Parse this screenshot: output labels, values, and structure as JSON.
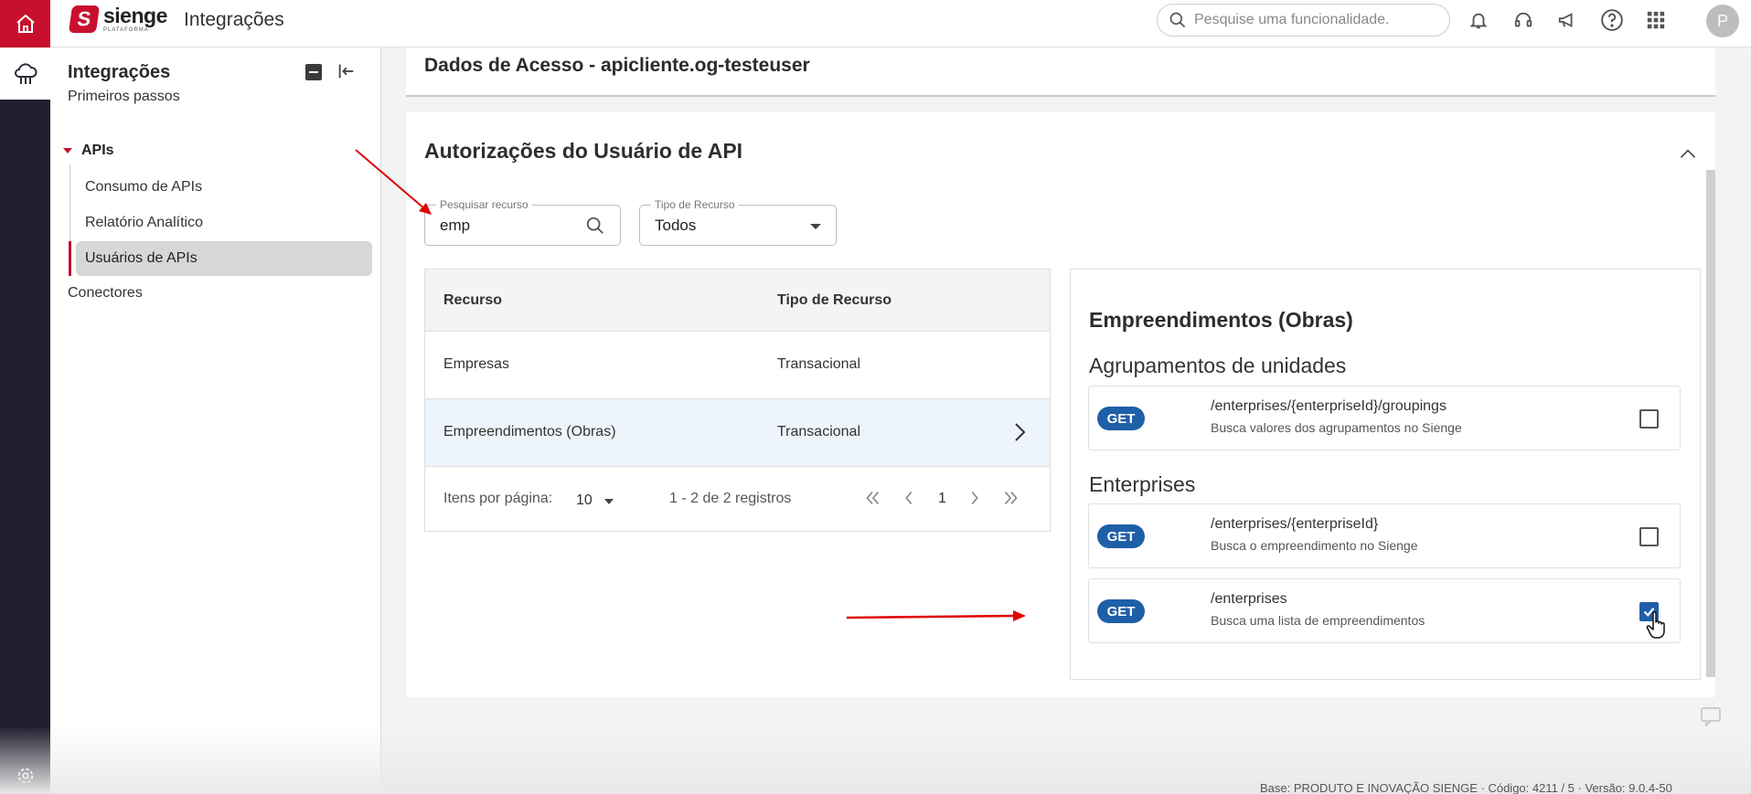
{
  "topbar": {
    "logo_name": "sienge",
    "logo_sub": "PLATAFORMA",
    "logo_letter": "S",
    "app_title": "Integrações",
    "search_placeholder": "Pesquise uma funcionalidade.",
    "avatar_letter": "P",
    "icons": [
      "bell-icon",
      "headset-icon",
      "megaphone-icon",
      "help-icon",
      "apps-grid-icon"
    ]
  },
  "rail": {
    "icons": [
      "home-icon",
      "cloud-integration-icon",
      "gear-icon"
    ],
    "accent": "#c8102e",
    "bg": "#1f1f2e"
  },
  "sidebar": {
    "title": "Integrações",
    "items": {
      "first_steps": "Primeiros passos",
      "apis": "APIs",
      "api_consumption": "Consumo de APIs",
      "analytics_report": "Relatório Analítico",
      "api_users": "Usuários de APIs",
      "connectors": "Conectores"
    }
  },
  "previous_section": {
    "title": "Dados de Acesso - apicliente.og-testeuser"
  },
  "authorizations": {
    "title": "Autorizações do Usuário de API",
    "search": {
      "label": "Pesquisar recurso",
      "value": "emp"
    },
    "type_filter": {
      "label": "Tipo de Recurso",
      "value": "Todos"
    },
    "table": {
      "headers": {
        "resource": "Recurso",
        "type": "Tipo de Recurso"
      },
      "rows": [
        {
          "resource": "Empresas",
          "type": "Transacional"
        },
        {
          "resource": "Empreendimentos (Obras)",
          "type": "Transacional"
        }
      ],
      "pagination": {
        "per_page_label": "Itens por página:",
        "per_page_value": "10",
        "range": "1 - 2 de 2 registros",
        "current_page": "1"
      }
    },
    "detail": {
      "title": "Empreendimentos (Obras)",
      "groups": [
        {
          "name": "Agrupamentos de unidades",
          "endpoints": [
            {
              "method": "GET",
              "path": "/enterprises/{enterpriseId}/groupings",
              "description": "Busca valores dos agrupamentos no Sienge",
              "checked": false
            }
          ]
        },
        {
          "name": "Enterprises",
          "endpoints": [
            {
              "method": "GET",
              "path": "/enterprises/{enterpriseId}",
              "description": "Busca o empreendimento no Sienge",
              "checked": false
            },
            {
              "method": "GET",
              "path": "/enterprises",
              "description": "Busca uma lista de empreendimentos",
              "checked": true
            }
          ]
        }
      ]
    }
  },
  "footer": {
    "text": "Base: PRODUTO E INOVAÇÃO SIENGE · Código: 4211 / 5 · Versão: 9.0.4-50"
  },
  "colors": {
    "accent_red": "#c8102e",
    "badge_blue": "#1f5fa8",
    "selected_row": "#eef4fb",
    "annotation_arrow": "#e00000"
  }
}
